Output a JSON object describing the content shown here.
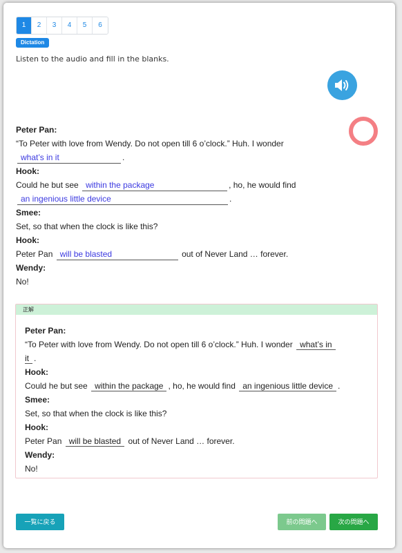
{
  "pagination": {
    "pages": [
      "1",
      "2",
      "3",
      "4",
      "5",
      "6"
    ],
    "active_index": 0
  },
  "badge": "Dictation",
  "instruction": "Listen to the audio and fill in the blanks.",
  "icons": {
    "audio": "speaker-icon",
    "record": "record-ring-icon"
  },
  "exercise": {
    "peter_label": "Peter Pan:",
    "peter_text": "“To Peter with love from Wendy. Do not open till 6 o’clock.” Huh. I wonder",
    "blank1": "what’s in it",
    "end1": ".",
    "hook1_label": "Hook:",
    "hook1_text_a": "Could he but see",
    "blank2": "within the package",
    "hook1_text_b": ", ho, he would find",
    "blank3": "an ingenious little device",
    "end3": ".",
    "smee_label": "Smee:",
    "smee_text": "Set, so that when the clock is like this?",
    "hook2_label": "Hook:",
    "hook2_text_a": "Peter Pan",
    "blank4": "will be blasted",
    "hook2_text_b": "out of Never Land … forever.",
    "wendy_label": "Wendy:",
    "wendy_text": "No!"
  },
  "answer": {
    "header": "正解",
    "peter_label": "Peter Pan:",
    "peter_text": "“To Peter with love from Wendy. Do not open till 6 o’clock.” Huh. I wonder",
    "a1_part1": "what’s in",
    "a1_part2": "it",
    "end1": ".",
    "hook1_label": "Hook:",
    "hook1_text_a": "Could he but see",
    "a2": "within the package",
    "hook1_text_b": ", ho, he would find",
    "a3": "an ingenious little device",
    "end3": ".",
    "smee_label": "Smee:",
    "smee_text": "Set, so that when the clock is like this?",
    "hook2_label": "Hook:",
    "hook2_text_a": "Peter Pan",
    "a4": "will be blasted",
    "hook2_text_b": "out of Never Land … forever.",
    "wendy_label": "Wendy:",
    "wendy_text": "No!"
  },
  "buttons": {
    "back_to_list": "一覧に戻る",
    "prev": "前の問題へ",
    "next": "次の問題へ"
  },
  "colors": {
    "primary": "#1e88e5",
    "blank_text": "#3b39e0",
    "record_ring": "#f47f84",
    "answer_header_bg": "#cdf1d8",
    "back_button": "#17a2b8",
    "next_button": "#28a745"
  }
}
